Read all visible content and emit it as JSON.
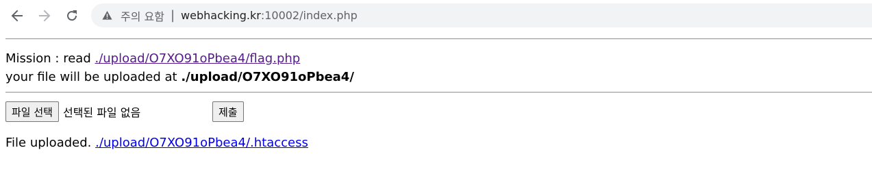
{
  "browser": {
    "security_label": "주의 요함",
    "separator": "|",
    "url_host": "webhacking.kr",
    "url_path": ":10002/index.php"
  },
  "page": {
    "mission_prefix": "Mission : read ",
    "mission_link": "./upload/O7XO91oPbea4/flag.php",
    "upload_prefix": "your file will be uploaded at ",
    "upload_path": "./upload/O7XO91oPbea4/",
    "choose_file_label": "파일 선택",
    "no_file_text": "선택된 파일 없음",
    "submit_label": "제출",
    "result_prefix": "File uploaded. ",
    "result_link": "./upload/O7XO91oPbea4/.htaccess"
  },
  "icons": {
    "back": "arrow-left-icon",
    "forward": "arrow-right-icon",
    "reload": "reload-icon",
    "warning": "warning-triangle-icon"
  }
}
